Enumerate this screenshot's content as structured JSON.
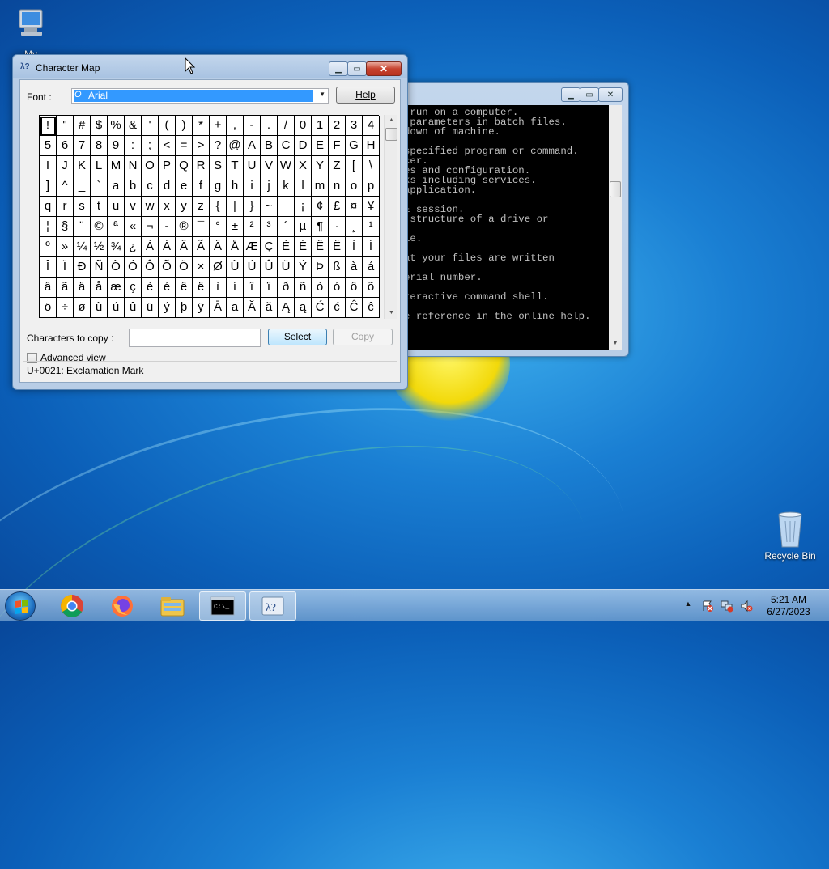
{
  "desktop": {
    "my_computer_label": "My Computer",
    "recycle_bin_label": "Recycle Bin"
  },
  "charmap": {
    "title": "Character Map",
    "font_label": "Font :",
    "font_value": "Arial",
    "help_label": "Help",
    "rows": [
      [
        "!",
        "\"",
        "#",
        "$",
        "%",
        "&",
        "'",
        "(",
        ")",
        "*",
        "+",
        ",",
        "-",
        ".",
        "/",
        "0",
        "1",
        "2",
        "3",
        "4"
      ],
      [
        "5",
        "6",
        "7",
        "8",
        "9",
        ":",
        ";",
        "<",
        "=",
        ">",
        "?",
        "@",
        "A",
        "B",
        "C",
        "D",
        "E",
        "F",
        "G",
        "H"
      ],
      [
        "I",
        "J",
        "K",
        "L",
        "M",
        "N",
        "O",
        "P",
        "Q",
        "R",
        "S",
        "T",
        "U",
        "V",
        "W",
        "X",
        "Y",
        "Z",
        "[",
        "\\"
      ],
      [
        "]",
        "^",
        "_",
        "`",
        "a",
        "b",
        "c",
        "d",
        "e",
        "f",
        "g",
        "h",
        "i",
        "j",
        "k",
        "l",
        "m",
        "n",
        "o",
        "p"
      ],
      [
        "q",
        "r",
        "s",
        "t",
        "u",
        "v",
        "w",
        "x",
        "y",
        "z",
        "{",
        "|",
        "}",
        "~",
        " ",
        "¡",
        "¢",
        "£",
        "¤",
        "¥"
      ],
      [
        "¦",
        "§",
        "¨",
        "©",
        "ª",
        "«",
        "¬",
        "-",
        "®",
        "¯",
        "°",
        "±",
        "²",
        "³",
        "´",
        "µ",
        "¶",
        "·",
        "¸",
        "¹"
      ],
      [
        "º",
        "»",
        "¼",
        "½",
        "¾",
        "¿",
        "À",
        "Á",
        "Â",
        "Ã",
        "Ä",
        "Å",
        "Æ",
        "Ç",
        "È",
        "É",
        "Ê",
        "Ë",
        "Ì",
        "Í"
      ],
      [
        "Î",
        "Ï",
        "Ð",
        "Ñ",
        "Ò",
        "Ó",
        "Ô",
        "Õ",
        "Ö",
        "×",
        "Ø",
        "Ù",
        "Ú",
        "Û",
        "Ü",
        "Ý",
        "Þ",
        "ß",
        "à",
        "á"
      ],
      [
        "â",
        "ã",
        "ä",
        "å",
        "æ",
        "ç",
        "è",
        "é",
        "ê",
        "ë",
        "ì",
        "í",
        "î",
        "ï",
        "ð",
        "ñ",
        "ò",
        "ó",
        "ô",
        "õ"
      ],
      [
        "ö",
        "÷",
        "ø",
        "ù",
        "ú",
        "û",
        "ü",
        "ý",
        "þ",
        "ÿ",
        "Ā",
        "ā",
        "Ă",
        "ă",
        "Ą",
        "ą",
        "Ć",
        "ć",
        "Ĉ",
        "ĉ"
      ]
    ],
    "copy_label": "Characters to copy :",
    "copy_value": "",
    "select_label": "Select",
    "copy_button_label": "Copy",
    "advanced_label": "Advanced view",
    "status": "U+0021: Exclamation Mark"
  },
  "console": {
    "lines": [
      " run on a computer.",
      " parameters in batch files.",
      "down of machine.",
      "",
      "specified program or command.",
      "cer.",
      "es and configuration.",
      "ks including services.",
      "application.",
      "",
      "E session.",
      " structure of a drive or",
      "",
      "le.",
      "",
      "at your files are written",
      "",
      "erial number.",
      "",
      "teractive command shell.",
      "",
      "e reference in the online help."
    ]
  },
  "taskbar": {
    "apps": [
      "chrome-icon",
      "firefox-icon",
      "file-explorer-icon",
      "command-prompt-icon",
      "character-map-icon"
    ],
    "clock_time": "5:21 AM",
    "clock_date": "6/27/2023"
  }
}
